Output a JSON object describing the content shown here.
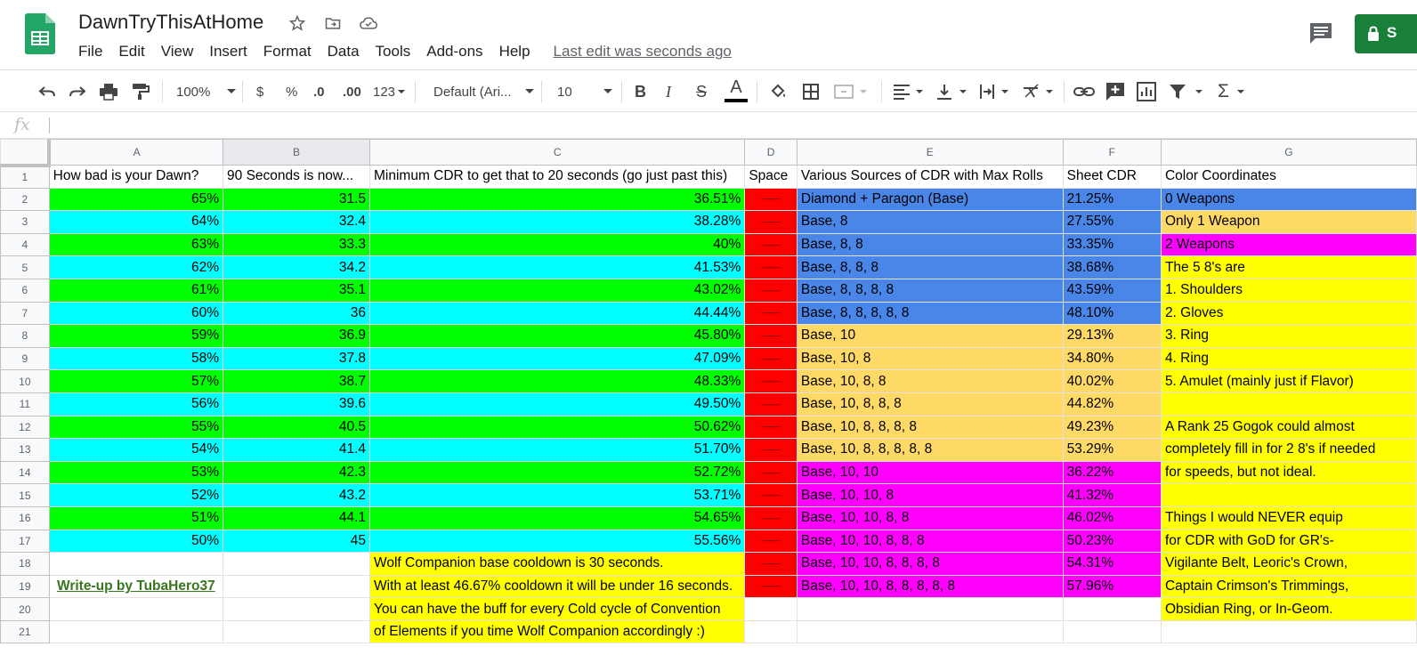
{
  "doc": {
    "title": "DawnTryThisAtHome",
    "share_label": "S",
    "last_edit": "Last edit was seconds ago"
  },
  "menu": [
    "File",
    "Edit",
    "View",
    "Insert",
    "Format",
    "Data",
    "Tools",
    "Add-ons",
    "Help"
  ],
  "toolbar": {
    "zoom": "100%",
    "currency": "$",
    "percent": "%",
    "dec_decrease": ".0",
    "dec_increase": ".00",
    "more_formats": "123",
    "font": "Default (Ari...",
    "font_size": "10",
    "bold": "B",
    "italic": "I",
    "strike": "S",
    "text_color": "A",
    "functions": "Σ"
  },
  "formula_bar": {
    "fx": "fx",
    "value": ""
  },
  "columns": [
    "A",
    "B",
    "C",
    "D",
    "E",
    "F",
    "G"
  ],
  "rows": [
    {
      "n": "1",
      "a": "How bad is your Dawn?",
      "b": "90 Seconds is now...",
      "c": "Minimum CDR to get that to 20 seconds (go just past this)",
      "d": "Space",
      "e": "Various Sources of CDR with Max Rolls",
      "f": "Sheet CDR",
      "g": "Color Coordinates"
    },
    {
      "n": "2",
      "a": "65%",
      "b": "31.5",
      "c": "36.51%",
      "d": "--------",
      "e": "Diamond + Paragon (Base)",
      "f": "21.25%",
      "g": "0 Weapons"
    },
    {
      "n": "3",
      "a": "64%",
      "b": "32.4",
      "c": "38.28%",
      "d": "--------",
      "e": "Base, 8",
      "f": "27.55%",
      "g": "Only 1 Weapon"
    },
    {
      "n": "4",
      "a": "63%",
      "b": "33.3",
      "c": "40%",
      "d": "--------",
      "e": "Base, 8, 8",
      "f": "33.35%",
      "g": "2 Weapons"
    },
    {
      "n": "5",
      "a": "62%",
      "b": "34.2",
      "c": "41.53%",
      "d": "--------",
      "e": "Base, 8, 8, 8",
      "f": "38.68%",
      "g": "The 5 8's are"
    },
    {
      "n": "6",
      "a": "61%",
      "b": "35.1",
      "c": "43.02%",
      "d": "--------",
      "e": "Base, 8, 8, 8, 8",
      "f": "43.59%",
      "g": "1. Shoulders"
    },
    {
      "n": "7",
      "a": "60%",
      "b": "36",
      "c": "44.44%",
      "d": "--------",
      "e": "Base, 8, 8, 8, 8, 8",
      "f": "48.10%",
      "g": "2. Gloves"
    },
    {
      "n": "8",
      "a": "59%",
      "b": "36.9",
      "c": "45.80%",
      "d": "--------",
      "e": "Base, 10",
      "f": "29.13%",
      "g": "3. Ring"
    },
    {
      "n": "9",
      "a": "58%",
      "b": "37.8",
      "c": "47.09%",
      "d": "--------",
      "e": "Base, 10, 8",
      "f": "34.80%",
      "g": "4. Ring"
    },
    {
      "n": "10",
      "a": "57%",
      "b": "38.7",
      "c": "48.33%",
      "d": "--------",
      "e": "Base, 10, 8, 8",
      "f": "40.02%",
      "g": "5. Amulet (mainly just if Flavor)"
    },
    {
      "n": "11",
      "a": "56%",
      "b": "39.6",
      "c": "49.50%",
      "d": "--------",
      "e": "Base, 10, 8, 8, 8",
      "f": "44.82%",
      "g": ""
    },
    {
      "n": "12",
      "a": "55%",
      "b": "40.5",
      "c": "50.62%",
      "d": "--------",
      "e": "Base, 10, 8, 8, 8, 8",
      "f": "49.23%",
      "g": "A Rank 25 Gogok could almost"
    },
    {
      "n": "13",
      "a": "54%",
      "b": "41.4",
      "c": "51.70%",
      "d": "--------",
      "e": "Base, 10, 8, 8, 8, 8, 8",
      "f": "53.29%",
      "g": "completely fill in for 2 8's if needed"
    },
    {
      "n": "14",
      "a": "53%",
      "b": "42.3",
      "c": "52.72%",
      "d": "--------",
      "e": "Base, 10, 10",
      "f": "36.22%",
      "g": "for speeds, but not ideal."
    },
    {
      "n": "15",
      "a": "52%",
      "b": "43.2",
      "c": "53.71%",
      "d": "--------",
      "e": "Base, 10, 10, 8",
      "f": "41.32%",
      "g": ""
    },
    {
      "n": "16",
      "a": "51%",
      "b": "44.1",
      "c": "54.65%",
      "d": "--------",
      "e": "Base, 10, 10, 8, 8",
      "f": "46.02%",
      "g": "Things I would NEVER equip"
    },
    {
      "n": "17",
      "a": "50%",
      "b": "45",
      "c": "55.56%",
      "d": "--------",
      "e": "Base, 10, 10, 8, 8, 8",
      "f": "50.23%",
      "g": "for CDR with GoD for GR's-"
    },
    {
      "n": "18",
      "a": "",
      "b": "",
      "c": "Wolf Companion base cooldown is 30 seconds.",
      "d": "--------",
      "e": "Base, 10, 10, 8, 8, 8, 8",
      "f": "54.31%",
      "g": "Vigilante Belt, Leoric's Crown,"
    },
    {
      "n": "19",
      "a": "Write-up by TubaHero37",
      "b": "",
      "c": "With at least 46.67% cooldown it will be under 16 seconds.",
      "d": "--------",
      "e": "Base, 10, 10, 8, 8, 8, 8, 8",
      "f": "57.96%",
      "g": " Captain Crimson's Trimmings,"
    },
    {
      "n": "20",
      "a": "",
      "b": "",
      "c": "You can have the buff for every Cold cycle of Convention",
      "d": "",
      "e": "",
      "f": "",
      "g": "Obsidian Ring, or In-Geom."
    },
    {
      "n": "21",
      "a": "",
      "b": "",
      "c": "of Elements if you time Wolf Companion accordingly :)",
      "d": "",
      "e": "",
      "f": "",
      "g": ""
    }
  ],
  "colors": {
    "green": "#00ff00",
    "cyan": "#00ffff",
    "red": "#ff0000",
    "blue": "#4a86e8",
    "orange": "#ffd966",
    "magenta": "#ff00ff",
    "yellow": "#ffff00",
    "share_green": "#188038"
  }
}
